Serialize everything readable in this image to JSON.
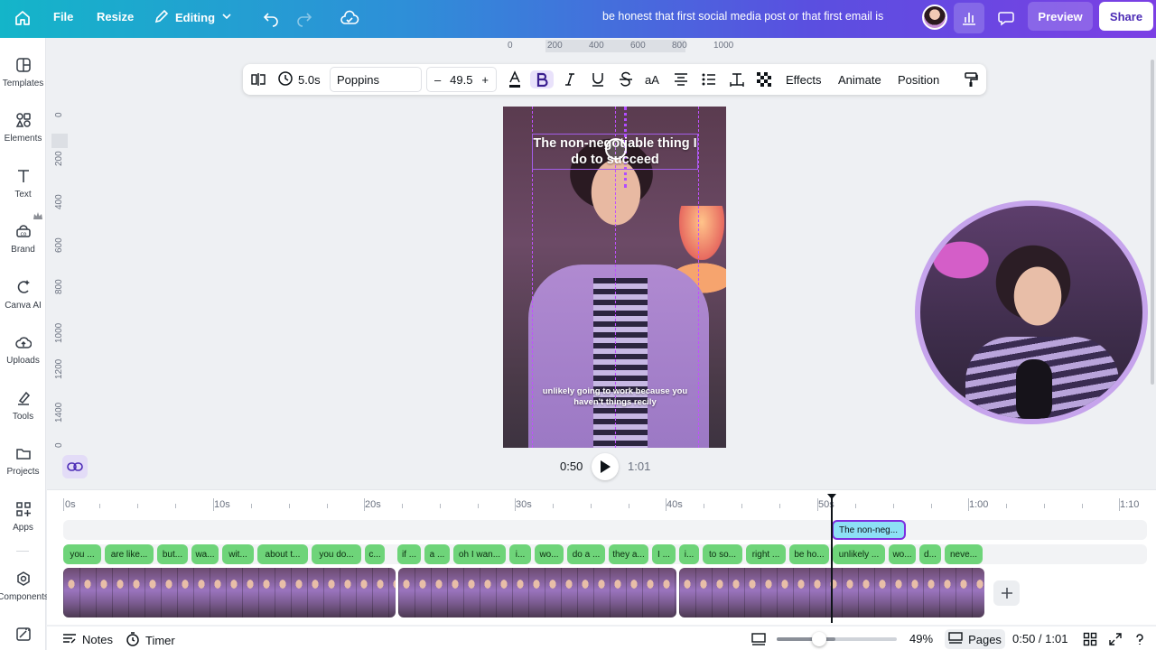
{
  "topbar": {
    "file": "File",
    "resize": "Resize",
    "editing": "Editing",
    "title": "be honest that first social media post or that first email is",
    "preview": "Preview",
    "share": "Share"
  },
  "sidebar": {
    "items": [
      {
        "label": "Templates",
        "icon": "templates-icon"
      },
      {
        "label": "Elements",
        "icon": "elements-icon"
      },
      {
        "label": "Text",
        "icon": "text-icon"
      },
      {
        "label": "Brand",
        "icon": "brand-icon"
      },
      {
        "label": "Canva AI",
        "icon": "canva-ai-icon"
      },
      {
        "label": "Uploads",
        "icon": "uploads-icon"
      },
      {
        "label": "Tools",
        "icon": "tools-icon"
      },
      {
        "label": "Projects",
        "icon": "projects-icon"
      },
      {
        "label": "Apps",
        "icon": "apps-icon"
      },
      {
        "label": "Components",
        "icon": "components-icon"
      }
    ]
  },
  "ruler": {
    "h": [
      "0",
      "200",
      "400",
      "600",
      "800",
      "1000"
    ],
    "v": [
      "0",
      "200",
      "400",
      "600",
      "800",
      "1000",
      "1200",
      "1400",
      "0"
    ]
  },
  "format": {
    "duration": "5.0s",
    "font": "Poppins",
    "size": "49.5",
    "minus": "–",
    "plus": "+",
    "case": "aA",
    "effects": "Effects",
    "animate": "Animate",
    "position": "Position"
  },
  "canvas": {
    "title": "The non-negotiable thing I do to succeed",
    "caption": "unlikely going to work because you haven't things recily"
  },
  "playback": {
    "current": "0:50",
    "total": "1:01"
  },
  "timeline": {
    "ruler": [
      "0s",
      "10s",
      "20s",
      "30s",
      "40s",
      "50s",
      "1:00",
      "1:10"
    ],
    "text_clip": "The non-neg...",
    "captions": [
      "you ...",
      "are like...",
      "but...",
      "wa...",
      "wit...",
      "about t...",
      "you do...",
      "c...",
      "if ...",
      "a ...",
      "oh I wan...",
      "i...",
      "wo...",
      "do a ...",
      "they a...",
      "I ...",
      "i...",
      "to so...",
      "right ...",
      "be ho...",
      "unlikely ...",
      "wo...",
      "d...",
      "neve..."
    ]
  },
  "bottom": {
    "notes": "Notes",
    "timer": "Timer",
    "zoom": "49%",
    "zoom_level": 0.49,
    "pages": "Pages",
    "time": "0:50 / 1:01"
  },
  "colors": {
    "accent": "#7d2fe0",
    "caption_clip": "#6ed479",
    "text_clip": "#8de0f5"
  }
}
